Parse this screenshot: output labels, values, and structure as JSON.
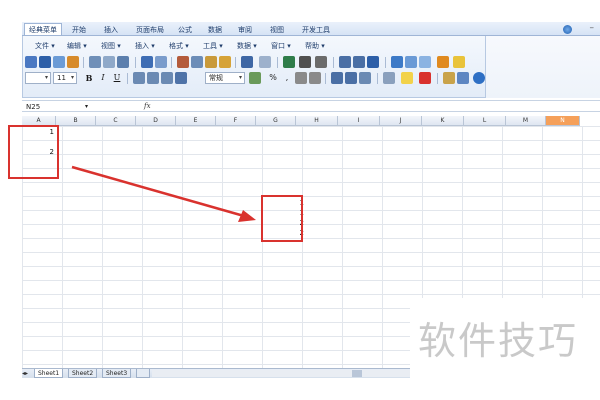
{
  "ribbon": {
    "tabs": [
      "经典菜单",
      "开始",
      "插入",
      "页面布局",
      "公式",
      "数据",
      "审阅",
      "视图",
      "开发工具"
    ],
    "active_tab": 0
  },
  "menu": [
    "文件 ▾",
    "编辑 ▾",
    "视图 ▾",
    "插入 ▾",
    "格式 ▾",
    "工具 ▾",
    "数据 ▾",
    "窗口 ▾",
    "帮助 ▾"
  ],
  "font_size": "11",
  "number_format": "常规",
  "format_buttons": {
    "bold": "B",
    "italic": "I",
    "underline": "U"
  },
  "name_box": "N25",
  "fx_label": "fx",
  "columns": [
    "A",
    "B",
    "C",
    "D",
    "E",
    "F",
    "G",
    "H",
    "I",
    "J",
    "K",
    "L",
    "M",
    "N"
  ],
  "active_column": "N",
  "cells": {
    "a1": "1",
    "a3": "2",
    "g1": "1",
    "g2": "1",
    "g3": "2",
    "g4": "2"
  },
  "sheets": [
    "Sheet1",
    "Sheet2",
    "Sheet3"
  ],
  "watermark": "软件技巧",
  "colors": {
    "accent": "#d9322e",
    "active_col": "#f5a05a"
  }
}
